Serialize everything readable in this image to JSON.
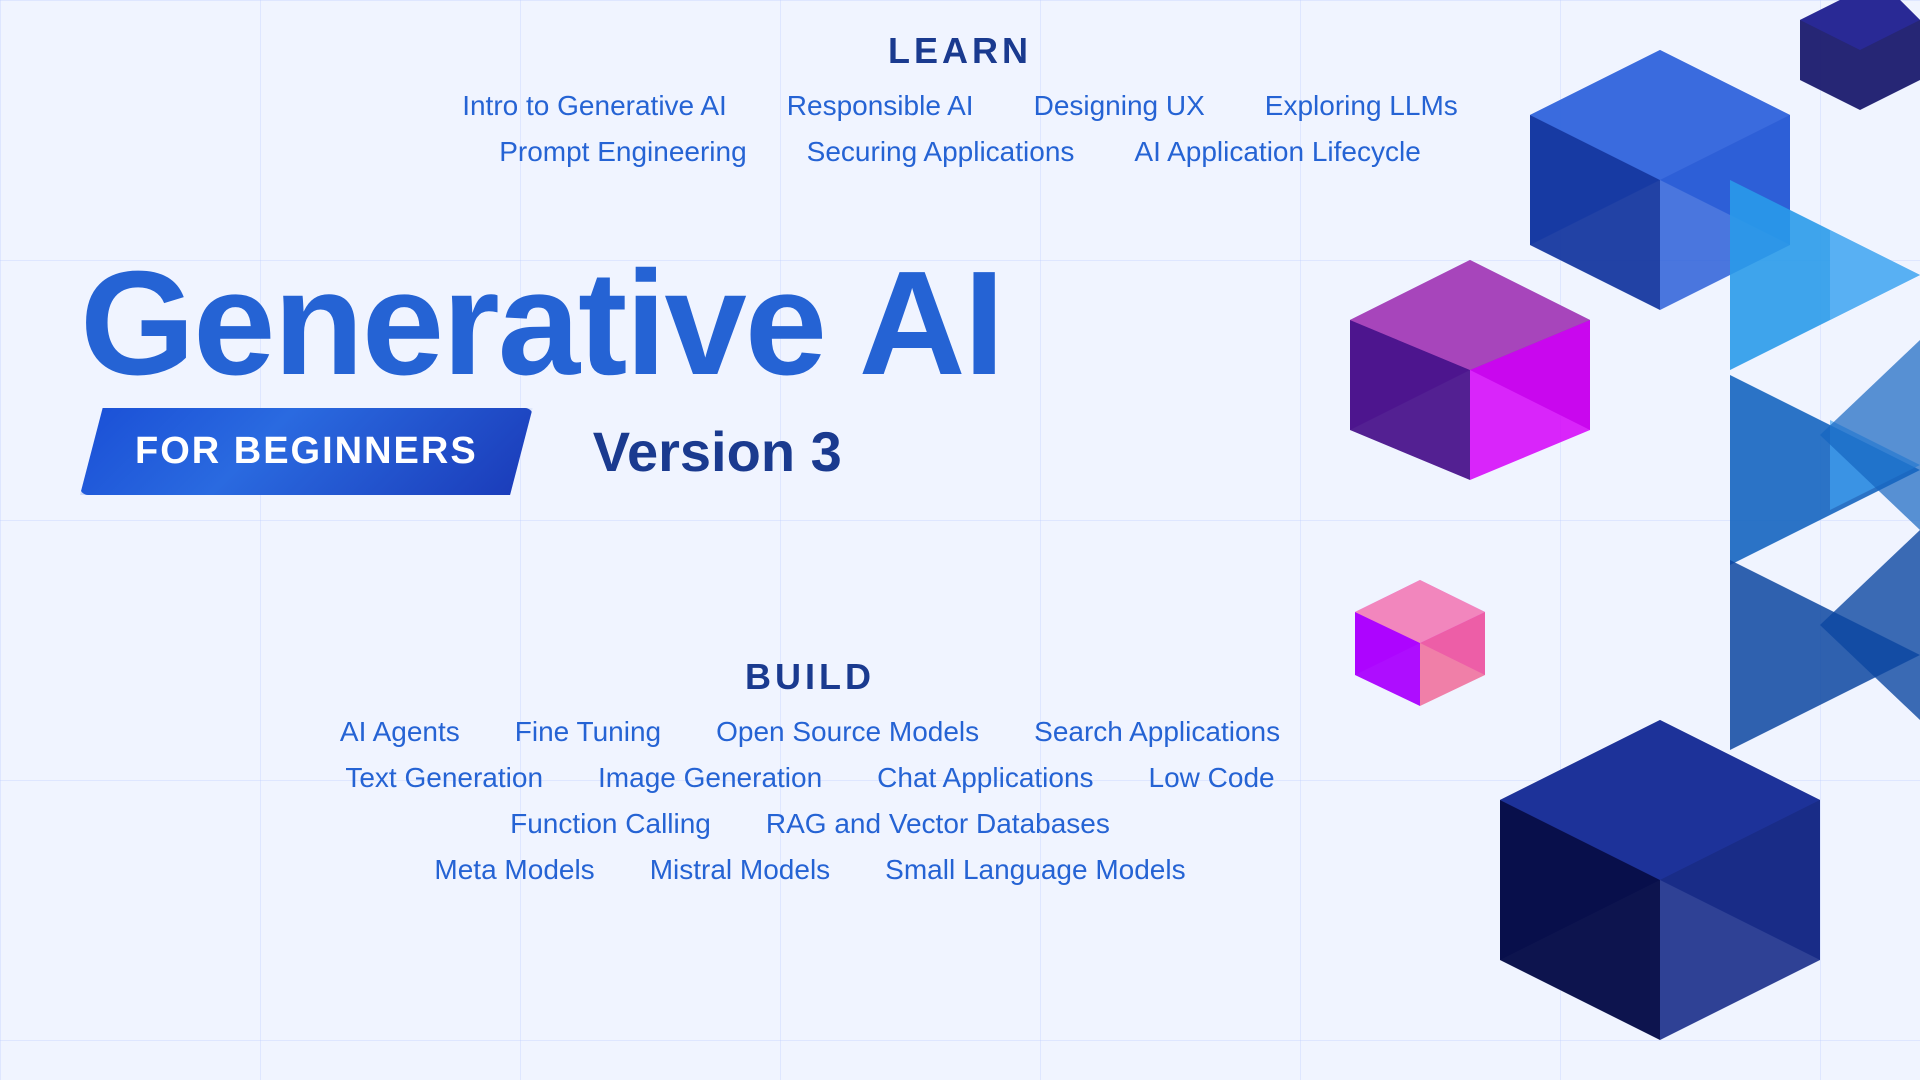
{
  "learn": {
    "sectionTitle": "LEARN",
    "row1": [
      "Intro to Generative AI",
      "Responsible AI",
      "Designing UX",
      "Exploring LLMs"
    ],
    "row2": [
      "Prompt Engineering",
      "Securing Applications",
      "AI Application Lifecycle"
    ]
  },
  "hero": {
    "titleLine1": "Generative AI",
    "badge": "FOR BEGINNERS",
    "version": "Version 3"
  },
  "build": {
    "sectionTitle": "BUILD",
    "row1": [
      "AI Agents",
      "Fine Tuning",
      "Open Source Models",
      "Search Applications"
    ],
    "row2": [
      "Text Generation",
      "Image Generation",
      "Chat Applications",
      "Low Code"
    ],
    "row3": [
      "Function Calling",
      "RAG and Vector Databases"
    ],
    "row4": [
      "Meta Models",
      "Mistral Models",
      "Small Language Models"
    ]
  },
  "colors": {
    "primary": "#2563d4",
    "dark": "#1a3a8f",
    "accent_purple": "#8b2fc9",
    "accent_magenta": "#d040d0",
    "blue_light": "#4a90d9",
    "blue_mid": "#2255cc",
    "navy": "#0a0a5e"
  }
}
